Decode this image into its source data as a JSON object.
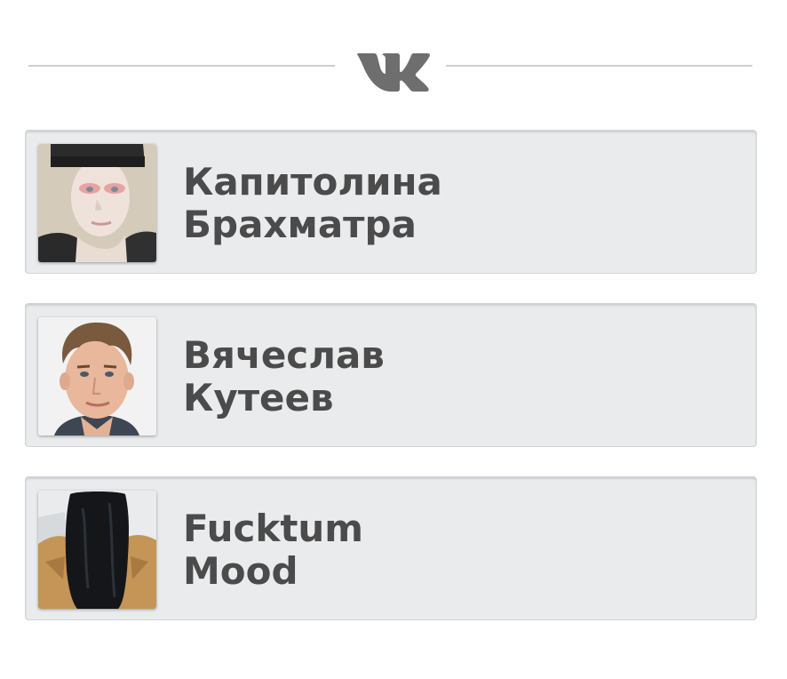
{
  "header": {
    "logo_icon": "vk-logo-icon",
    "logo_color": "#6e6e6e",
    "divider_color": "#cfcfcf"
  },
  "friends": [
    {
      "first_line": "Капитолина",
      "second_line": "Брахматра",
      "avatar_icon": "user-avatar-photo"
    },
    {
      "first_line": "Вячеслав",
      "second_line": "Кутеев",
      "avatar_icon": "user-avatar-photo"
    },
    {
      "first_line": "Fucktum",
      "second_line": "Mood",
      "avatar_icon": "user-avatar-photo"
    }
  ],
  "colors": {
    "card_background": "#eaebed",
    "name_text": "#4b4b4b"
  }
}
